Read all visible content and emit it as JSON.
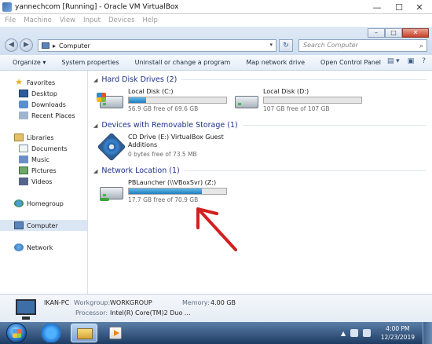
{
  "vbox": {
    "title": "yannechcom [Running] - Oracle VM VirtualBox",
    "menu": [
      "File",
      "Machine",
      "View",
      "Input",
      "Devices",
      "Help"
    ],
    "controls": {
      "minimize": "—",
      "maximize": "☐",
      "close": "✕"
    }
  },
  "explorer": {
    "caption": {
      "minimize": "–",
      "maximize": "□",
      "close": "✕"
    },
    "nav": {
      "back": "◀",
      "forward": "▶"
    },
    "address": {
      "path": "Computer",
      "sep": "▸",
      "dropdown": "▾"
    },
    "refresh": "↻",
    "search": {
      "placeholder": "Search Computer",
      "icon": "⌕"
    },
    "commands": [
      "Organize ▾",
      "System properties",
      "Uninstall or change a program",
      "Map network drive",
      "Open Control Panel"
    ],
    "view_icons": [
      "▤ ▾",
      "▣",
      "?"
    ]
  },
  "navpane": {
    "favorites": {
      "label": "Favorites",
      "items": [
        "Desktop",
        "Downloads",
        "Recent Places"
      ]
    },
    "libraries": {
      "label": "Libraries",
      "items": [
        "Documents",
        "Music",
        "Pictures",
        "Videos"
      ]
    },
    "homegroup": "Homegroup",
    "computer": "Computer",
    "network": "Network"
  },
  "groups": {
    "hdd": {
      "header": "Hard Disk Drives (2)"
    },
    "removable": {
      "header": "Devices with Removable Storage (1)"
    },
    "network": {
      "header": "Network Location (1)"
    }
  },
  "drives": {
    "c": {
      "name": "Local Disk (C:)",
      "free": "56.9 GB free of 69.6 GB",
      "used_fraction": 0.18
    },
    "d": {
      "name": "Local Disk (D:)",
      "free": "107 GB free of 107 GB",
      "used_fraction": 0.0
    },
    "e": {
      "name_line1": "CD Drive (E:) VirtualBox Guest",
      "name_line2": "Additions",
      "free": "0 bytes free of 73.5 MB"
    },
    "z": {
      "name": "PBLauncher (\\\\VBoxSvr) (Z:)",
      "free": "17.7 GB free of 70.9 GB",
      "used_fraction": 0.75
    }
  },
  "details": {
    "computer_name": "IKAN-PC",
    "workgroup_label": "Workgroup:",
    "workgroup": "WORKGROUP",
    "memory_label": "Memory:",
    "memory": "4.00 GB",
    "processor_label": "Processor:",
    "processor": "Intel(R) Core(TM)2 Duo ..."
  },
  "taskbar": {
    "time": "4:00 PM",
    "date": "12/23/2019",
    "tray_arrow": "▲"
  },
  "colors": {
    "bar_fill": "#1f7fc0",
    "annotation_arrow": "#d21f1f",
    "group_header": "#1e3287"
  }
}
